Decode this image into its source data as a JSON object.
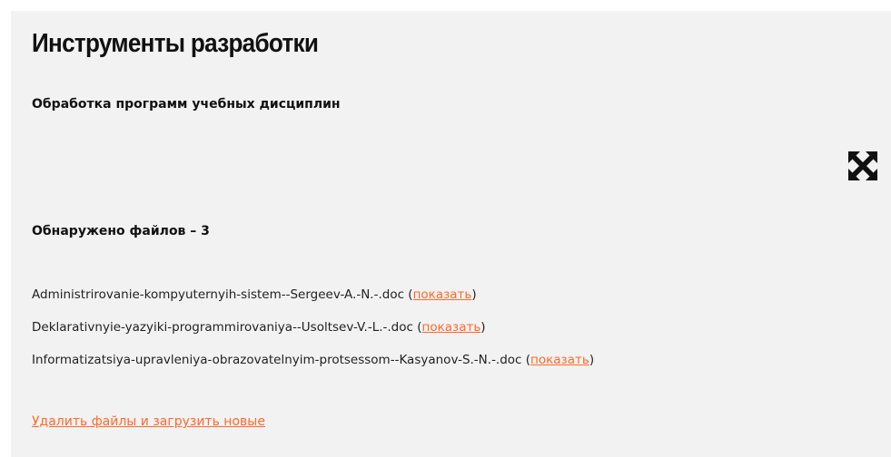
{
  "page": {
    "title": "Инструменты разработки",
    "subtitle": "Обработка программ учебных дисциплин",
    "found_label": "Обнаружено файлов – 3",
    "files": [
      {
        "name": "Administrirovanie-kompyuternyih-sistem--Sergeev-A.-N.-.doc",
        "action": "показать"
      },
      {
        "name": "Deklarativnyie-yazyiki-programmirovaniya--Usoltsev-V.-L.-.doc",
        "action": "показать"
      },
      {
        "name": "Informatizatsiya-upravleniya-obrazovatelnyim-protsessom--Kasyanov-S.-N.-.doc",
        "action": "показать"
      }
    ],
    "reset_link": "Удалить файлы и загрузить новые",
    "expand_icon": "expand-arrows-icon"
  },
  "colors": {
    "panel_background": "#f2f2f2",
    "link": "#ff6a2b",
    "text": "#111111"
  }
}
